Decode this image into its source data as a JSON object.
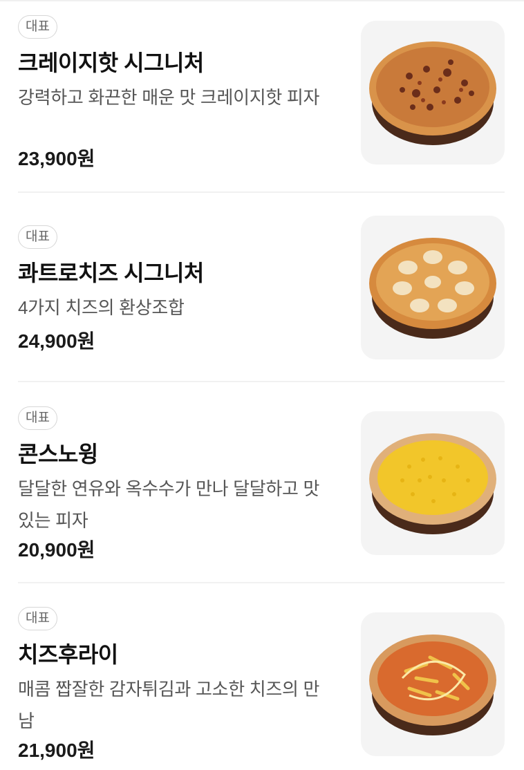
{
  "menu": {
    "items": [
      {
        "badge": "대표",
        "name": "크레이지핫 시그니처",
        "description": "강력하고 화끈한 매운 맛 크레이지핫 피자",
        "price": "23,900원",
        "image": "pizza-meat-image"
      },
      {
        "badge": "대표",
        "name": "콰트로치즈 시그니처",
        "description": "4가지 치즈의 환상조합",
        "price": "24,900원",
        "image": "pizza-cheese-image"
      },
      {
        "badge": "대표",
        "name": "콘스노윙",
        "description": "달달한 연유와 옥수수가 만나 달달하고 맛있는 피자",
        "price": "20,900원",
        "image": "pizza-corn-image"
      },
      {
        "badge": "대표",
        "name": "치즈후라이",
        "description": "매콤 짭잘한 감자튀김과 고소한 치즈의 만남",
        "price": "21,900원",
        "image": "pizza-fries-image"
      }
    ]
  }
}
